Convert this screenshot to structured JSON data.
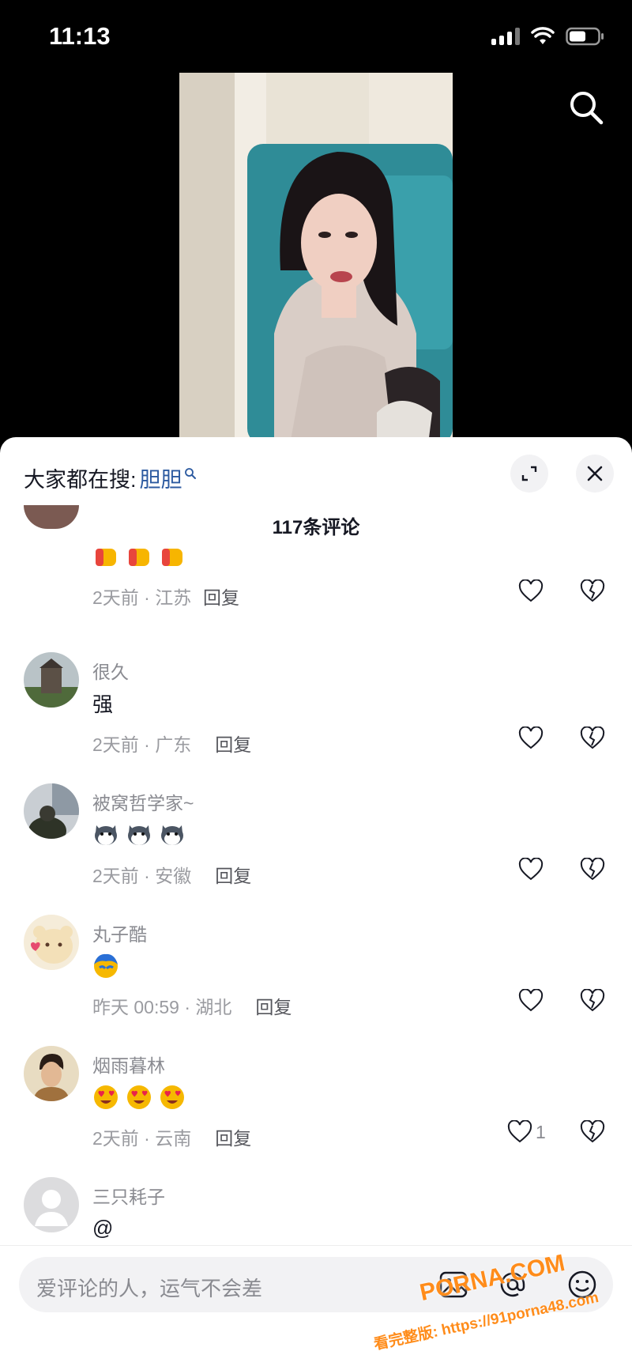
{
  "status_bar": {
    "time": "11:13"
  },
  "header": {
    "trending_label": "大家都在搜:",
    "trending_term": "胆胆",
    "comment_count": "117条评论"
  },
  "comments": [
    {
      "name": "",
      "body": "",
      "meta": "2天前 · 江苏",
      "reply": "回复",
      "likes": ""
    },
    {
      "name": "很久",
      "body": "强",
      "meta": "2天前 · 广东",
      "reply": "回复",
      "likes": ""
    },
    {
      "name": "被窝哲学家~",
      "body": "",
      "meta": "2天前 · 安徽",
      "reply": "回复",
      "likes": ""
    },
    {
      "name": "丸子酷",
      "body": "",
      "meta": "昨天 00:59 · 湖北",
      "reply": "回复",
      "likes": ""
    },
    {
      "name": "烟雨暮林",
      "body": "",
      "meta": "2天前 · 云南",
      "reply": "回复",
      "likes": "1"
    },
    {
      "name": "三只耗子",
      "body": "@",
      "meta": "",
      "reply": "",
      "likes": ""
    }
  ],
  "input": {
    "placeholder": "爱评论的人，运气不会差"
  },
  "watermark": {
    "brand": "PORNA.COM",
    "slogan": "看完整版: https://91porna48.com"
  },
  "colors": {
    "accent_link": "#2c5aa0",
    "sheet_bg": "#ffffff",
    "heart": "#161823"
  }
}
